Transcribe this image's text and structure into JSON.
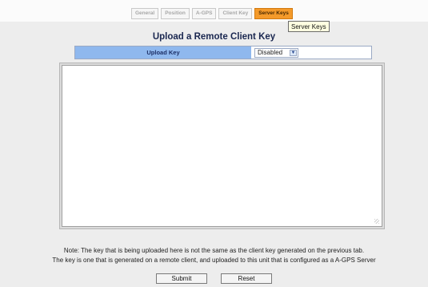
{
  "tabs": [
    {
      "label": "General",
      "active": false
    },
    {
      "label": "Position",
      "active": false
    },
    {
      "label": "A-GPS",
      "active": false
    },
    {
      "label": "Client Key",
      "active": false
    },
    {
      "label": "Server Keys",
      "active": true
    }
  ],
  "tooltip": "Server Keys",
  "page_title": "Upload a Remote Client Key",
  "upload_key": {
    "label": "Upload Key",
    "selected": "Disabled",
    "arrow_icon": "chevron-down-icon"
  },
  "textarea": {
    "value": ""
  },
  "note": {
    "line1": "Note: The key that is being uploaded here is not the same as the client key generated on the previous tab.",
    "line2": "The key is one that is generated on a remote client, and uploaded to this unit that is configured as a A-GPS Server"
  },
  "buttons": {
    "submit": "Submit",
    "reset": "Reset"
  },
  "colors": {
    "active_tab": "#f49a2a",
    "label_cell": "#8fb8ee",
    "title": "#1a2750",
    "background": "#ededed"
  }
}
